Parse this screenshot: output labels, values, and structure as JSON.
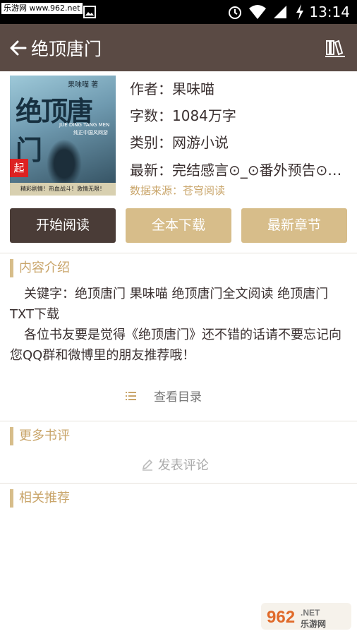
{
  "statusbar": {
    "watermark": "乐游网 www.962.net",
    "time": "13:14"
  },
  "appbar": {
    "title": "绝顶唐门",
    "back_icon": "arrow-left-icon",
    "shelf_icon": "bookshelf-icon"
  },
  "cover": {
    "title": "绝顶唐门",
    "author": "果味喵 著",
    "pinyin": "JUE DING TANG MEN",
    "sub": "纯正中国风网游",
    "badge": "起",
    "footer": "精彩剧情！热血战斗！激情无限！"
  },
  "book": {
    "author_line": "作者：果味喵",
    "words_line": "字数：1084万字",
    "category_line": "类别：网游小说",
    "latest_line": "最新：完结感言⊙_⊙番外预告⊙…",
    "source_line": "数据来源：苍穹阅读"
  },
  "buttons": {
    "start_reading": "开始阅读",
    "download_all": "全本下载",
    "latest_chapter": "最新章节"
  },
  "sections": {
    "intro_title": "内容介绍",
    "intro_p1": "关键字：绝顶唐门 果味喵 绝顶唐门全文阅读 绝顶唐门TXT下载",
    "intro_p2": "各位书友要是觉得《绝顶唐门》还不错的话请不要忘记向您QQ群和微博里的朋友推荐哦！",
    "toc_label": "查看目录",
    "reviews_title": "更多书评",
    "post_comment": "发表评论",
    "related_title": "相关推荐"
  },
  "watermark_bottom": "962.NET 乐游网",
  "colors": {
    "appbar": "#5a4a44",
    "accent_gold": "#d7bd8a",
    "button_dark": "#4a3c37"
  }
}
